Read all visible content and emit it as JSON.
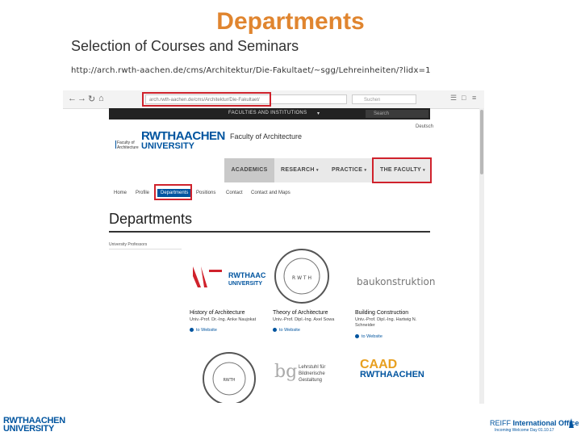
{
  "slide": {
    "title": "Departments",
    "subtitle": "Selection of Courses and Seminars",
    "url": "http://arch.rwth-aachen.de/cms/Architektur/Die-Fakultaet/~sgg/Lehreinheiten/?lidx=1"
  },
  "browser": {
    "address_text": "arch.rwth-aachen.de/cms/Architektur/Die-Fakultaet/",
    "search_placeholder": "Suchen",
    "icons": [
      "back-icon",
      "forward-icon",
      "reload-icon",
      "home-icon",
      "library-icon",
      "sidebar-icon",
      "menu-icon"
    ]
  },
  "site": {
    "topbar_label": "FACULTIES AND INSTITUTIONS",
    "topbar_search": "Search",
    "faculty_mini": [
      "Faculty of",
      "Architecture"
    ],
    "logo_line1": "RWTHAACHEN",
    "logo_line2": "UNIVERSITY",
    "faculty_title": "Faculty of Architecture",
    "language": "Deutsch",
    "menu": [
      {
        "label": "ACADEMICS",
        "active": true
      },
      {
        "label": "RESEARCH",
        "active": false
      },
      {
        "label": "PRACTICE",
        "active": false
      },
      {
        "label": "THE FACULTY",
        "active": false
      }
    ],
    "subnav": [
      "Home",
      "Profile",
      "Departments",
      "Positions",
      "Contact",
      "Contact and Maps"
    ],
    "selected_subnav": "Departments",
    "page_heading": "Departments",
    "section_label": "University Professors",
    "professorships": [
      {
        "name": "History of Architecture",
        "person": "Univ.-Prof. Dr.-Ing. Anke Naujokat",
        "link": "to Website",
        "logo": "rwth-history-logo"
      },
      {
        "name": "Theory of Architecture",
        "person": "Univ.-Prof. Dipl.-Ing. Axel Sowa",
        "link": "to Website",
        "logo": "architekturtheorie-seal"
      },
      {
        "name": "Building Construction",
        "person": "Univ.-Prof. Dipl.-Ing. Hartwig N. Schneider",
        "link": "to Website",
        "logo": "baukonstruktion-logo"
      }
    ],
    "second_row": [
      {
        "logo": "lehrstuhl-seal"
      },
      {
        "logo": "bg-lehrstuhl-logo",
        "text_line1": "Lehrstuhl für",
        "text_line2": "Bildnerische Gestaltung"
      },
      {
        "logo": "caad-logo",
        "text_line1": "CAAD",
        "text_line2": "RWTHAACHEN"
      }
    ],
    "baukonstruktion_text": "baukonstruktion"
  },
  "footer": {
    "logo_line1": "RWTHAACHEN",
    "logo_line2": "UNIVERSITY",
    "office_prefix": "REIFF",
    "office_name": "International Office",
    "office_sub": "Incoming Welcome Day 01.10.17"
  },
  "colors": {
    "title_orange": "#e0852f",
    "rwth_blue": "#00549f",
    "highlight_red": "#d0222c"
  }
}
